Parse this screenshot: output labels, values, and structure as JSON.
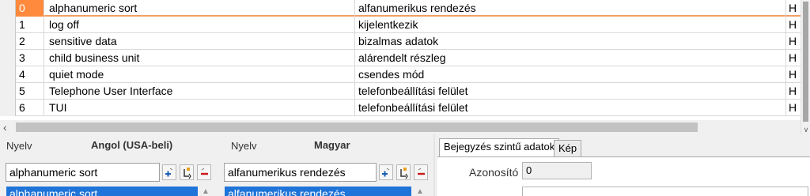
{
  "table": {
    "rows": [
      {
        "index": "0",
        "english": "alphanumeric sort",
        "hungarian": "alfanumerikus rendezés",
        "extra": "H",
        "selected": true
      },
      {
        "index": "1",
        "english": "log off",
        "hungarian": "kijelentkezik",
        "extra": "H"
      },
      {
        "index": "2",
        "english": "sensitive data",
        "hungarian": "bizalmas adatok",
        "extra": "H"
      },
      {
        "index": "3",
        "english": "child business unit",
        "hungarian": "alárendelt részleg",
        "extra": "H"
      },
      {
        "index": "4",
        "english": "quiet mode",
        "hungarian": "csendes mód",
        "extra": "H"
      },
      {
        "index": "5",
        "english": "Telephone User Interface",
        "hungarian": "telefonbeállítási felület",
        "extra": "H"
      },
      {
        "index": "6",
        "english": "TUI",
        "hungarian": "telefonbeállítási felület",
        "extra": "H"
      }
    ]
  },
  "left_pane": {
    "language_label": "Nyelv",
    "language_name": "Angol (USA-beli)",
    "term_value": "alphanumeric sort",
    "list_selected": "alphanumeric sort"
  },
  "middle_pane": {
    "language_label": "Nyelv",
    "language_name": "Magyar",
    "term_value": "alfanumerikus rendezés",
    "list_selected": "alfanumerikus rendezés"
  },
  "right_pane": {
    "tabs": [
      "Bejegyzés szintű adatok",
      "Kép"
    ],
    "id_label": "Azonosító",
    "id_value": "0"
  },
  "colors": {
    "selection_orange": "#ff8a3d",
    "list_selection_blue": "#1e74d8"
  }
}
